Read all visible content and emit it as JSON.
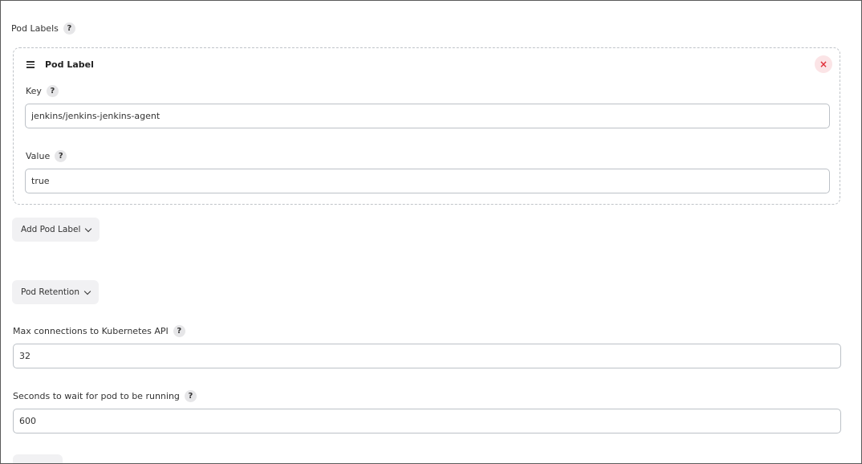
{
  "pod_labels": {
    "section_label": "Pod Labels",
    "item": {
      "title": "Pod Label",
      "key_label": "Key",
      "key_value": "jenkins/jenkins-jenkins-agent",
      "value_label": "Value",
      "value_value": "true",
      "remove_glyph": "×"
    },
    "add_button": "Add Pod Label"
  },
  "pod_retention": {
    "button": "Pod Retention"
  },
  "max_connections": {
    "label": "Max connections to Kubernetes API",
    "value": "32"
  },
  "wait_seconds": {
    "label": "Seconds to wait for pod to be running",
    "value": "600"
  },
  "help_glyph": "?"
}
